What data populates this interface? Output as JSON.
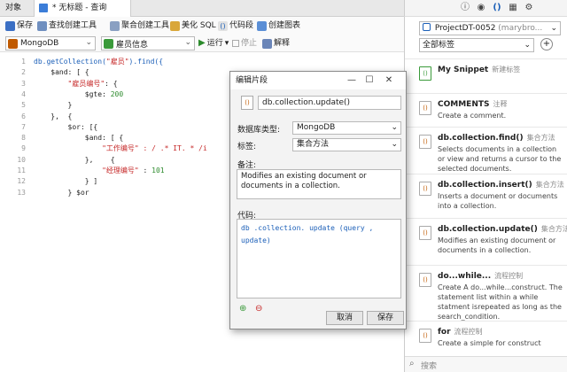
{
  "tabs": {
    "objects": "对象",
    "query": "* 无标题 - 查询"
  },
  "toolbar": {
    "save": "保存",
    "find_builder": "查找创建工具",
    "aggregate_builder": "聚合创建工具",
    "beautify": "美化 SQL",
    "snippet": "代码段",
    "create_chart": "创建图表"
  },
  "toolbar2": {
    "connection": "MongoDB",
    "database": "雇员信息",
    "run": "运行",
    "stop": "停止",
    "explain": "解释"
  },
  "editor": {
    "line_numbers": [
      "1",
      "2",
      "3",
      "4",
      "5",
      "6",
      "7",
      "8",
      "9",
      "10",
      "11",
      "12",
      "13"
    ],
    "lines": [
      {
        "parts": [
          {
            "t": "db.getCollection(",
            "c": "fn"
          },
          {
            "t": "\"雇员\"",
            "c": "str"
          },
          {
            "t": ").find({",
            "c": "fn"
          }
        ]
      },
      {
        "parts": [
          {
            "t": "    $and: [ {",
            "c": ""
          }
        ]
      },
      {
        "parts": [
          {
            "t": "        ",
            "c": ""
          },
          {
            "t": "\"雇员编号\"",
            "c": "str"
          },
          {
            "t": ": {",
            "c": ""
          }
        ]
      },
      {
        "parts": [
          {
            "t": "            $gte: ",
            "c": ""
          },
          {
            "t": "200",
            "c": "num"
          }
        ]
      },
      {
        "parts": [
          {
            "t": "        }",
            "c": ""
          }
        ]
      },
      {
        "parts": [
          {
            "t": "    },  {",
            "c": ""
          }
        ]
      },
      {
        "parts": [
          {
            "t": "        $or: [{",
            "c": ""
          }
        ]
      },
      {
        "parts": [
          {
            "t": "            $and: [ {",
            "c": ""
          }
        ]
      },
      {
        "parts": [
          {
            "t": "                ",
            "c": ""
          },
          {
            "t": "\"工作编号\" : / .* IT. * /i",
            "c": "str"
          }
        ]
      },
      {
        "parts": [
          {
            "t": "            },    {",
            "c": ""
          }
        ]
      },
      {
        "parts": [
          {
            "t": "                ",
            "c": ""
          },
          {
            "t": "\"经理编号\"",
            "c": "str"
          },
          {
            "t": " : ",
            "c": ""
          },
          {
            "t": "101",
            "c": "num"
          }
        ]
      },
      {
        "parts": [
          {
            "t": "            } ]",
            "c": ""
          }
        ]
      },
      {
        "parts": [
          {
            "t": "        } $or",
            "c": ""
          }
        ]
      }
    ]
  },
  "dialog": {
    "title": "编辑片段",
    "name": "db.collection.update()",
    "db_type_label": "数据库类型:",
    "db_type_value": "MongoDB",
    "tag_label": "标签:",
    "tag_value": "集合方法",
    "note_label": "备注:",
    "note_value": "Modifies an existing document or documents in a collection.",
    "code_label": "代码:",
    "code_value": "db .collection. update (query , update)",
    "cancel": "取消",
    "save": "保存"
  },
  "right": {
    "project": "ProjectDT-0052",
    "project_suffix": "(marybro...",
    "tag_filter": "全部标签",
    "search_placeholder": "搜索",
    "snippets": [
      {
        "title": "My Snippet",
        "cat": "新建标签",
        "desc": ""
      },
      {
        "title": "COMMENTS",
        "cat": "注释",
        "desc": "Create a comment."
      },
      {
        "title": "db.collection.find()",
        "cat": "集合方法",
        "desc": "Selects documents in a collection or view and returns a cursor to the selected documents."
      },
      {
        "title": "db.collection.insert()",
        "cat": "集合方法",
        "desc": "Inserts  a document or documents into a collection."
      },
      {
        "title": "db.collection.update()",
        "cat": "集合方法",
        "desc": "Modifies an existing document or documents  in  a collection."
      },
      {
        "title": "do...while...",
        "cat": "流程控制",
        "desc": "Create A do...while...construct. The statement list within a while statment isrepeated as long as the search_condition."
      },
      {
        "title": "for",
        "cat": "流程控制",
        "desc": "Create a simple for construct"
      }
    ]
  },
  "colors": {
    "accent": "#1b5fb8",
    "string": "#c62828",
    "number": "#2e8b2e",
    "brand_orange": "#c05a00"
  }
}
